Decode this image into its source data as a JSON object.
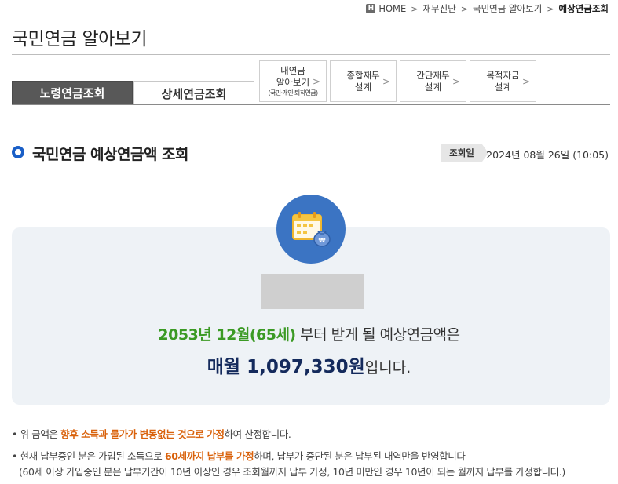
{
  "breadcrumb": {
    "home_icon": "H",
    "home": "HOME",
    "items": [
      "재무진단",
      "국민연금 알아보기"
    ],
    "current": "예상연금조회",
    "separator": ">"
  },
  "page_title": "국민연금 알아보기",
  "tabs": {
    "active": "노령연금조회",
    "inactive": "상세연금조회"
  },
  "design_buttons": [
    {
      "line1": "내연금",
      "line2": "알아보기",
      "sub": "(국민·개인·퇴직연금)"
    },
    {
      "line1": "종합재무",
      "line2": "설계"
    },
    {
      "line1": "간단재무",
      "line2": "설계"
    },
    {
      "line1": "목적자금",
      "line2": "설계"
    }
  ],
  "chevron": ">",
  "section": {
    "title": "국민연금 예상연금액 조회",
    "date_label": "조회일",
    "date_value": "2024년 08월 26일 (10:05)"
  },
  "result": {
    "start_highlight": "2053년 12월(65세)",
    "start_rest": " 부터 받게 될 예상연금액은",
    "amount_highlight": "매월 1,097,330원",
    "amount_rest": "입니다."
  },
  "notes": {
    "bullet": "•",
    "n1_pre": " 위 금액은 ",
    "n1_highlight": "향후 소득과 물가가 변동없는 것으로 가정",
    "n1_post": "하여 산정합니다.",
    "n2_pre": " 현재 납부중인 분은 가입된 소득으로 ",
    "n2_highlight": "60세까지 납부를 가정",
    "n2_post": "하며, 납부가 중단된 분은 납부된 내역만을 반영합니다",
    "n3": "(60세 이상 가입중인 분은 납부기간이 10년 이상인 경우 조회월까지 납부 가정, 10년 미만인 경우 10년이 되는 월까지 납부를 가정합니다.)"
  },
  "colors": {
    "accent_blue": "#1a5fc7",
    "circle_blue": "#3b74c3",
    "green": "#3b9a24",
    "orange": "#d9620c",
    "navy": "#142a5c",
    "box_bg": "#eef2f6"
  },
  "icons": {
    "home": "home-icon",
    "chevron": "chevron-right-icon",
    "calendar": "calendar-money-icon",
    "section_bullet": "circle-bullet-icon"
  }
}
